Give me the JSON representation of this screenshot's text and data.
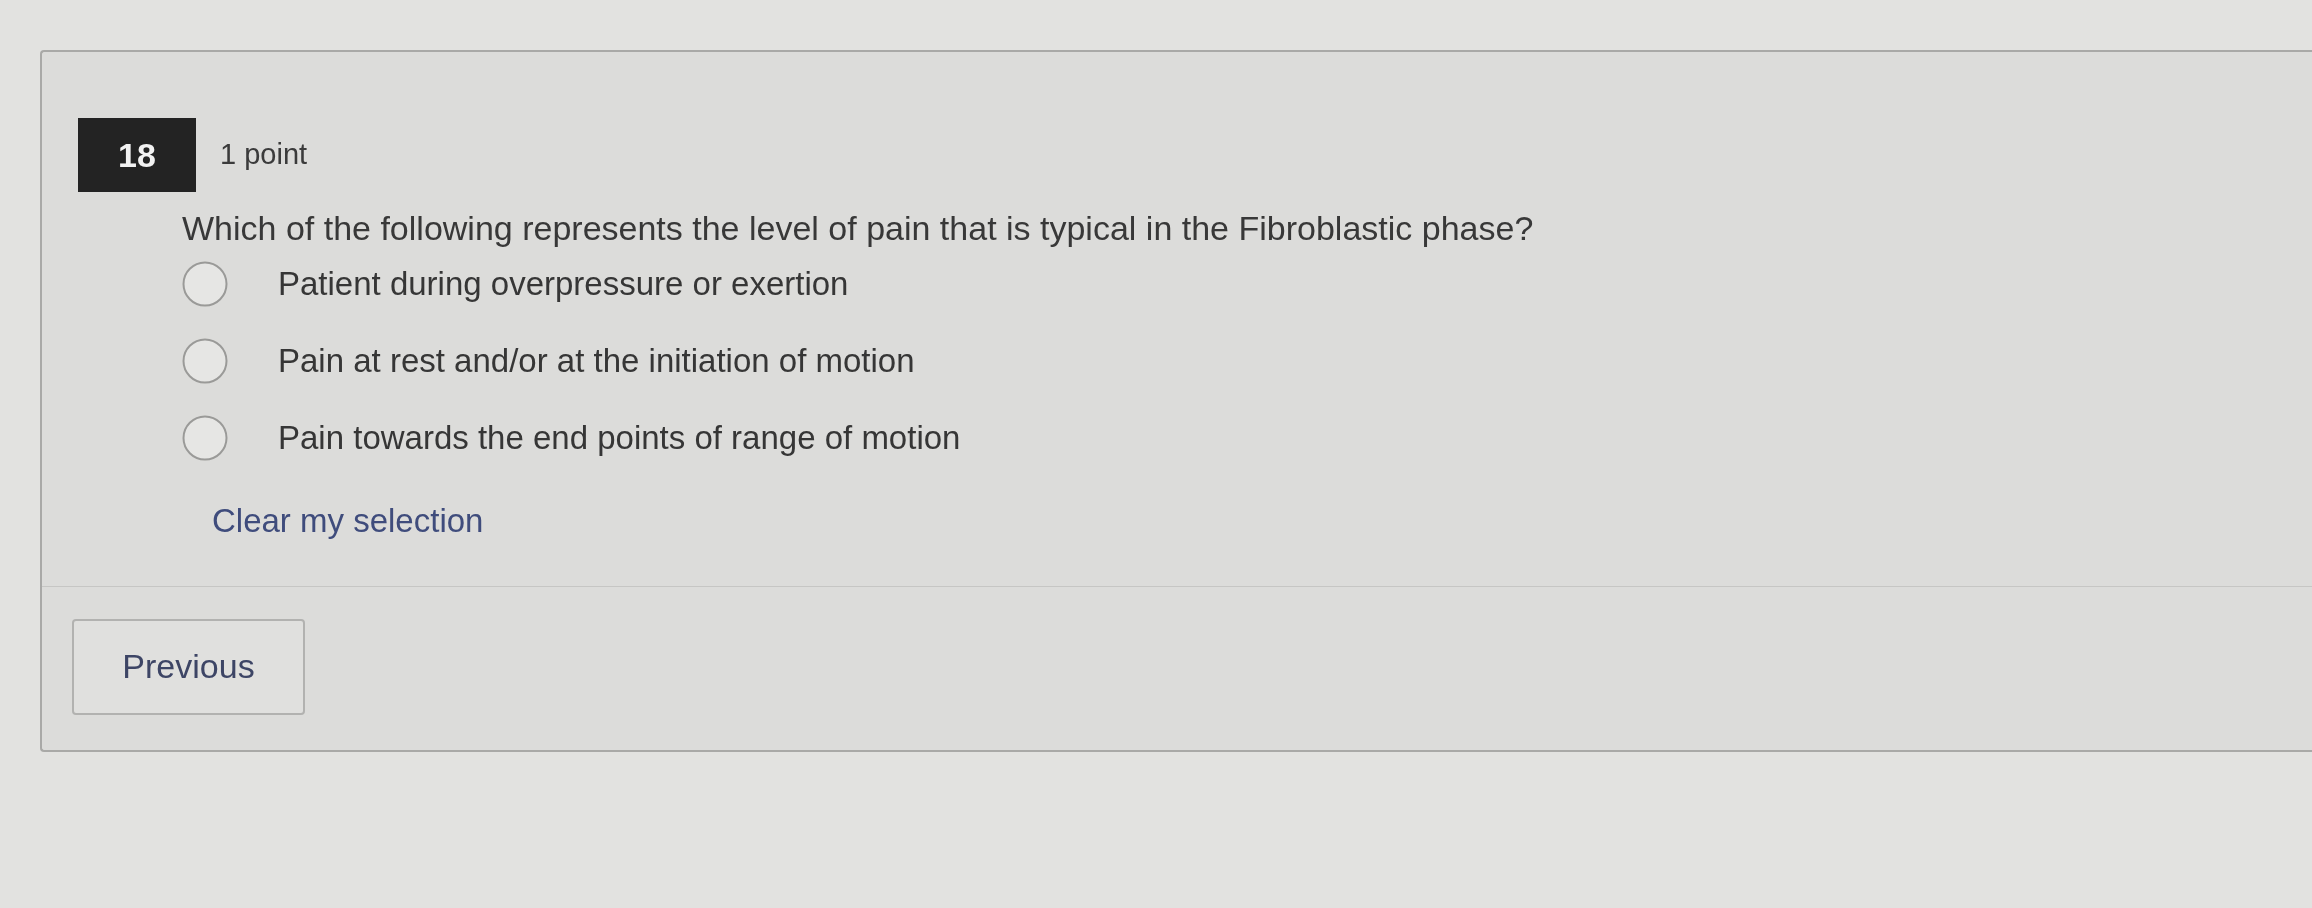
{
  "question": {
    "number": "18",
    "points": "1 point",
    "text": "Which of the following represents the level of pain that is typical in the Fibroblastic phase?",
    "options": [
      {
        "label": "Patient during overpressure or exertion",
        "selected": false
      },
      {
        "label": "Pain at rest and/or at the initiation of motion",
        "selected": false
      },
      {
        "label": "Pain towards the end points of range of motion",
        "selected": false
      }
    ],
    "clear_link": "Clear my selection"
  },
  "navigation": {
    "previous_button": "Previous"
  }
}
